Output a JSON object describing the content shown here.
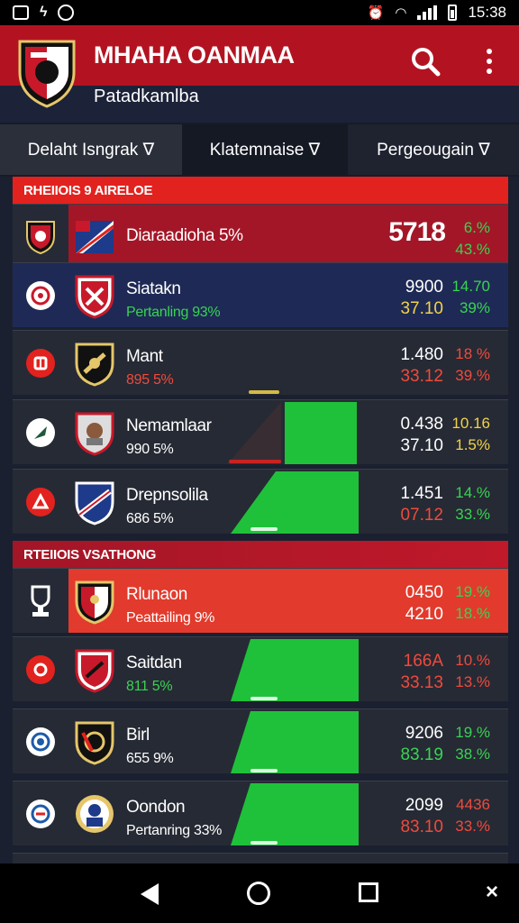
{
  "status_bar": {
    "time": "15:38"
  },
  "app": {
    "title": "MHAHA OANMAA",
    "subtitle": "Patadkamlba"
  },
  "filters": [
    "Delaht Isngrak ∇",
    "Klatemnaise ∇",
    "Pergeougain ∇"
  ],
  "sections": [
    {
      "header": "RHEIIOIS 9 AIRELOE",
      "rows": [
        {
          "name": "Diaraadioha 5%",
          "sub": "",
          "big": "5718",
          "pct1": "6.%",
          "pct2": "43.%",
          "style": "highlight-red"
        },
        {
          "name": "Siatakn",
          "sub": "Pertanling 93%",
          "val1": "9900",
          "val2": "37.10",
          "pct1": "14.70",
          "pct2": "39%",
          "style": "highlight-blue"
        },
        {
          "name": "Mant",
          "sub": "895 5%",
          "val1": "1.480",
          "val2": "33.12",
          "pct1": "18 %",
          "pct2": "39.%",
          "style": ""
        },
        {
          "name": "Nemamlaar",
          "sub": "990 5%",
          "val1": "0.438",
          "val2": "37.10",
          "pct1": "10.16",
          "pct2": "1.5%",
          "style": ""
        },
        {
          "name": "Drepnsolila",
          "sub": "686 5%",
          "val1": "1.451",
          "val2": "07.12",
          "pct1": "14.%",
          "pct2": "33.%",
          "style": ""
        }
      ]
    },
    {
      "header": "RTEIIOIS VSATHONG",
      "rows": [
        {
          "name": "Rlunaon",
          "sub": "Peattailing 9%",
          "val1": "0450",
          "val2": "4210",
          "pct1": "19.%",
          "pct2": "18.%",
          "style": "highlight-orange"
        },
        {
          "name": "Saitdan",
          "sub": "811 5%",
          "val1": "166A",
          "val2": "33.13",
          "pct1": "10.%",
          "pct2": "13.%",
          "style": ""
        },
        {
          "name": "Birl",
          "sub": "655 9%",
          "val1": "9206",
          "val2": "83.19",
          "pct1": "19.%",
          "pct2": "38.%",
          "style": ""
        },
        {
          "name": "Oondon",
          "sub": "Pertanring 33%",
          "val1": "2099",
          "val2": "83.10",
          "pct1": "4436",
          "pct2": "33.%",
          "style": ""
        }
      ]
    }
  ],
  "colors": {
    "brand_red": "#b31321",
    "accent_red": "#e2221e",
    "gain_green": "#1fc13a",
    "text_green": "#39d353",
    "text_red": "#f04a3c",
    "text_yellow": "#f2d24a"
  }
}
